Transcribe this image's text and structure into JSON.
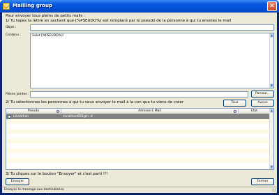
{
  "window": {
    "title": "Mailling group",
    "close_glyph": "✕"
  },
  "instructions": {
    "line1": "Pour envoyer tous pleins de petits mails :",
    "line2": "1/ Tu tapes ta lettre en sachant que [%PSEUDO%] est remplacé par le pseudo de la personne à qui tu envoies le mail",
    "line3": "2/ Tu sélectionnes les personnes à qui tu veux envoyer le mail à la con que tu viens de créer",
    "line4": "3/ Tu cliques sur le bouton \"Envoyer\" et c'est parti !!!"
  },
  "form": {
    "objet_label": "Objet :",
    "objet_value": "",
    "contenu_label": "Contenu :",
    "contenu_value": "Salut [%PSEUDO%]!",
    "pieces_label": "Pièces jointes :",
    "pieces_value": "",
    "parcourir_label": "Parcour..."
  },
  "selection_buttons": {
    "tous": "Tous",
    "aucun": "Aucun"
  },
  "grid": {
    "columns": [
      "Pseudo",
      "Adresse E Mail",
      "Etat"
    ],
    "rows": [
      {
        "checked": false,
        "pseudo": "Léviathan",
        "email": "leviathan666@h..d",
        "etat": ""
      }
    ]
  },
  "buttons": {
    "envoyer": "Envoyer",
    "fermer": "Fermer"
  },
  "statusbar": {
    "text": "Envoyer le message aux destinataires"
  },
  "icons": {
    "title": "mail-icon",
    "scroll_up": "▲",
    "scroll_down": "▼"
  }
}
